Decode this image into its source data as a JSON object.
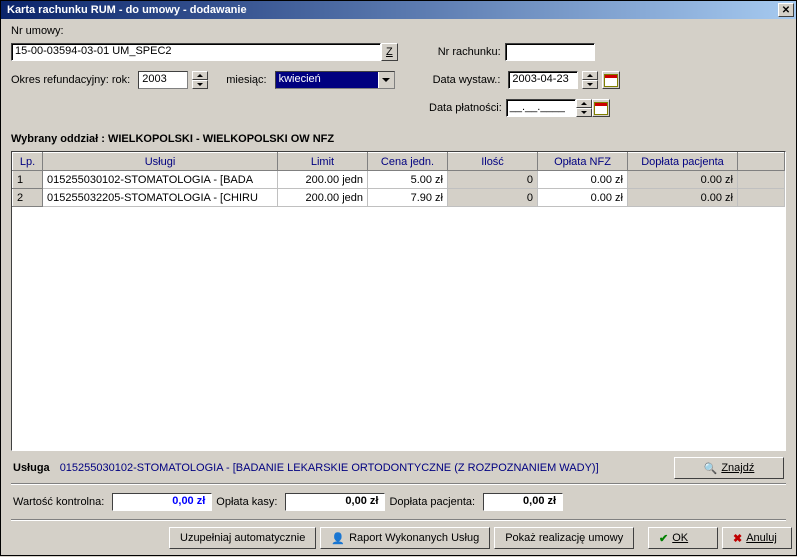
{
  "window": {
    "title": "Karta rachunku  RUM - do umowy  - dodawanie"
  },
  "header": {
    "contract_label": "Nr umowy:",
    "contract_value": "15-00-03594-03-01  UM_SPEC2",
    "z_button": "Z",
    "account_label": "Nr rachunku:",
    "account_value": "",
    "refund_label": "Okres refundacyjny:  rok:",
    "year": "2003",
    "month_label": "miesiąc:",
    "month": "kwiecień",
    "issue_date_label": "Data wystaw.:",
    "issue_date": "2003-04-23",
    "pay_date_label": "Data płatności:",
    "pay_date": "__.__.____"
  },
  "branch": {
    "text": "Wybrany oddział : WIELKOPOLSKI - WIELKOPOLSKI OW NFZ"
  },
  "grid": {
    "columns": [
      "Lp.",
      "Usługi",
      "Limit",
      "Cena jedn.",
      "Ilość",
      "Opłata NFZ",
      "Dopłata pacjenta"
    ],
    "rows": [
      {
        "lp": "1",
        "service": "015255030102-STOMATOLOGIA - [BADA",
        "limit": "200.00 jedn",
        "price": "5.00 zł",
        "qty": "0",
        "nfz": "0.00 zł",
        "patient": "0.00 zł",
        "selected": true
      },
      {
        "lp": "2",
        "service": "015255032205-STOMATOLOGIA - [CHIRU",
        "limit": "200.00 jedn",
        "price": "7.90 zł",
        "qty": "0",
        "nfz": "0.00 zł",
        "patient": "0.00 zł",
        "selected": false
      }
    ]
  },
  "footer": {
    "service_label": "Usługa",
    "service_link": "015255030102-STOMATOLOGIA - [BADANIE LEKARSKIE ORTODONTYCZNE (Z ROZPOZNANIEM WADY)]",
    "find_button": "Znajdź",
    "control_label": "Wartość kontrolna:",
    "control_value": "0,00 zł",
    "cash_label": "Opłata kasy:",
    "cash_value": "0,00 zł",
    "patient_label": "Dopłata pacjenta:",
    "patient_value": "0,00 zł",
    "auto_button": "Uzupełniaj automatycznie",
    "report_button": "Raport Wykonanych Usług",
    "show_button": "Pokaż realizację umowy",
    "ok_button": "OK",
    "cancel_button": "Anuluj"
  }
}
